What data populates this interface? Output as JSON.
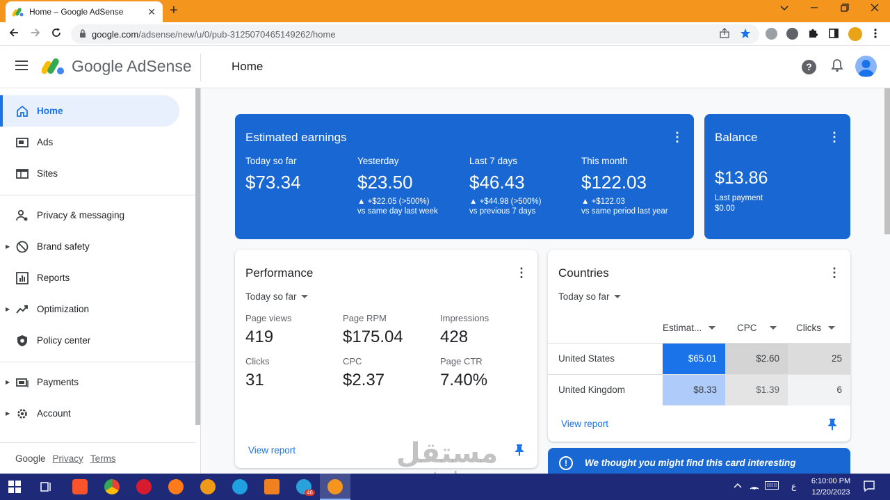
{
  "browser": {
    "tab_title": "Home – Google AdSense",
    "close_glyph": "✕",
    "new_tab_glyph": "+",
    "url_host": "google.com",
    "url_path": "/adsense/new/u/0/pub-3125070465149262/home"
  },
  "app": {
    "brand": "Google AdSense",
    "page_title": "Home",
    "help_glyph": "?"
  },
  "sidebar": {
    "items": [
      {
        "label": "Home",
        "icon": "home-icon"
      },
      {
        "label": "Ads",
        "icon": "ads-icon"
      },
      {
        "label": "Sites",
        "icon": "sites-icon"
      },
      {
        "label": "Privacy & messaging",
        "icon": "privacy-icon"
      },
      {
        "label": "Brand safety",
        "icon": "brand-safety-icon"
      },
      {
        "label": "Reports",
        "icon": "reports-icon"
      },
      {
        "label": "Optimization",
        "icon": "optimization-icon"
      },
      {
        "label": "Policy center",
        "icon": "policy-icon"
      },
      {
        "label": "Payments",
        "icon": "payments-icon"
      },
      {
        "label": "Account",
        "icon": "account-icon"
      }
    ],
    "footer": {
      "google": "Google",
      "privacy": "Privacy",
      "terms": "Terms"
    }
  },
  "earnings": {
    "title": "Estimated earnings",
    "columns": [
      {
        "label": "Today so far",
        "value": "$73.34",
        "change": "",
        "compare": ""
      },
      {
        "label": "Yesterday",
        "value": "$23.50",
        "change": "▲ +$22.05 (>500%)",
        "compare": "vs same day last week"
      },
      {
        "label": "Last 7 days",
        "value": "$46.43",
        "change": "▲ +$44.98 (>500%)",
        "compare": "vs previous 7 days"
      },
      {
        "label": "This month",
        "value": "$122.03",
        "change": "▲ +$122.03",
        "compare": "vs same period last year"
      }
    ]
  },
  "balance": {
    "title": "Balance",
    "value": "$13.86",
    "last_payment_label": "Last payment",
    "last_payment_value": "$0.00"
  },
  "performance": {
    "title": "Performance",
    "range": "Today so far",
    "metrics": [
      {
        "label": "Page views",
        "value": "419"
      },
      {
        "label": "Page RPM",
        "value": "$175.04"
      },
      {
        "label": "Impressions",
        "value": "428"
      },
      {
        "label": "Clicks",
        "value": "31"
      },
      {
        "label": "CPC",
        "value": "$2.37"
      },
      {
        "label": "Page CTR",
        "value": "7.40%"
      }
    ],
    "view_report": "View report"
  },
  "countries": {
    "title": "Countries",
    "range": "Today so far",
    "headers": [
      "Estimat...",
      "CPC",
      "Clicks"
    ],
    "rows": [
      {
        "country": "United States",
        "estimated": "$65.01",
        "cpc": "$2.60",
        "clicks": "25"
      },
      {
        "country": "United Kingdom",
        "estimated": "$8.33",
        "cpc": "$1.39",
        "clicks": "6"
      }
    ],
    "view_report": "View report"
  },
  "notice": {
    "text": "We thought you might find this card interesting"
  },
  "watermark": {
    "arabic": "مستقل",
    "latin": "mostaql.com"
  },
  "taskbar": {
    "time": "6:10:00 PM",
    "date": "12/20/2023",
    "lang": "ع",
    "telegram_badge": "46"
  },
  "colors": {
    "brand_blue": "#1967d2",
    "chrome_orange": "#f4961e",
    "taskbar": "#1e2a78",
    "heat_high": "#1a73e8",
    "heat_mid": "#aecbfa"
  }
}
